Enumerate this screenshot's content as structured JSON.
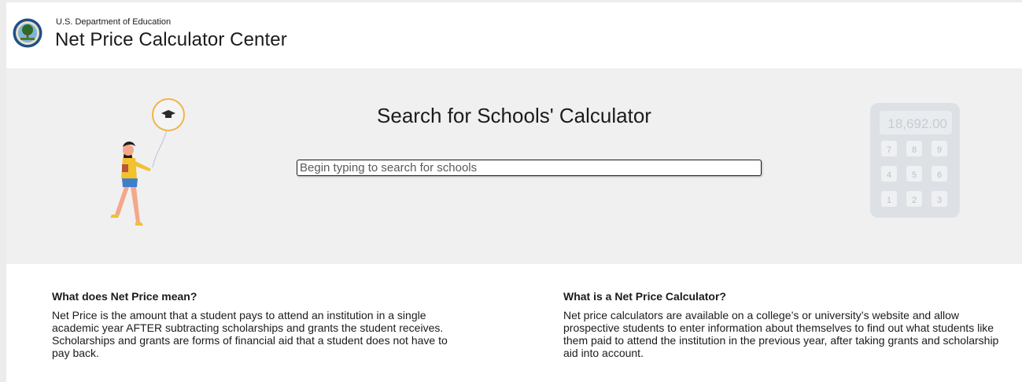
{
  "header": {
    "agency": "U.S. Department of Education",
    "title": "Net Price Calculator Center"
  },
  "hero": {
    "title": "Search for Schools' Calculator",
    "search_placeholder": "Begin typing to search for schools",
    "calculator_display": "18,692.00",
    "calculator_keys": [
      "7",
      "8",
      "9",
      "4",
      "5",
      "6",
      "1",
      "2",
      "3"
    ]
  },
  "info": {
    "left": {
      "heading": "What does Net Price mean?",
      "body": "Net Price is the amount that a student pays to attend an institution in a single academic year AFTER subtracting scholarships and grants the student receives. Scholarships and grants are forms of financial aid that a student does not have to pay back."
    },
    "right": {
      "heading": "What is a Net Price Calculator?",
      "body": "Net price calculators are available on a college’s or university’s website and allow prospective students to enter information about themselves to find out what students like them paid to attend the institution in the previous year, after taking grants and scholarship aid into account."
    }
  },
  "colors": {
    "hero_background": "#f0f0f0",
    "text": "#1b1b1b",
    "balloon": "#f0b54a",
    "calculator_body": "#dfe3e8"
  }
}
